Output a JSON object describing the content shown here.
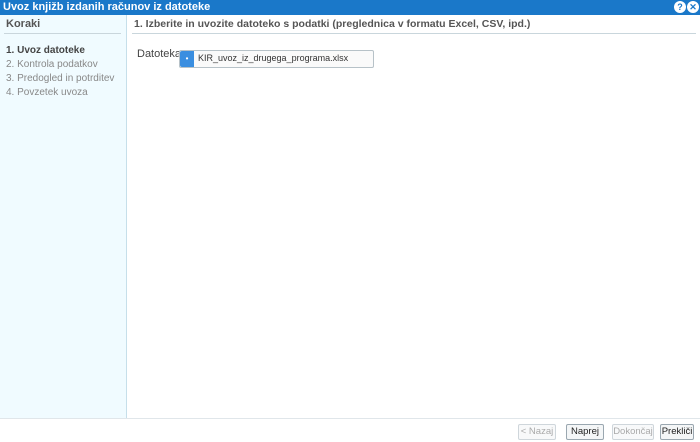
{
  "window": {
    "title": "Uvoz knjižb izdanih računov iz datoteke",
    "help_icon": "?",
    "close_icon": "✕"
  },
  "sidebar": {
    "heading": "Koraki",
    "steps": [
      {
        "label": "1. Uvoz datoteke",
        "active": true
      },
      {
        "label": "2. Kontrola podatkov",
        "active": false
      },
      {
        "label": "3. Predogled in potrditev",
        "active": false
      },
      {
        "label": "4. Povzetek uvoza",
        "active": false
      }
    ]
  },
  "main": {
    "step_title": "1. Izberite in uvozite datoteko s podatki (preglednica v formatu Excel, CSV, ipd.)",
    "file_label": "Datoteka:",
    "file_button_glyph": "•",
    "file_name": "KIR_uvoz_iz_drugega_programa.xlsx"
  },
  "footer": {
    "back_label": "< Nazaj",
    "next_label": "Naprej >",
    "finish_label": "Dokončaj",
    "cancel_label": "Prekliči"
  }
}
